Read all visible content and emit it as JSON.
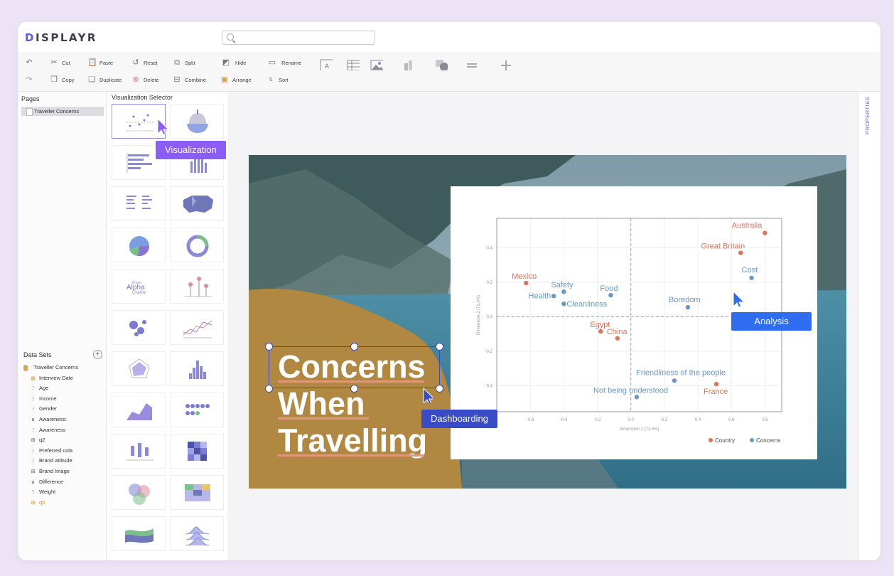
{
  "app": {
    "logo": "DISPLAYR",
    "search_placeholder": ""
  },
  "toolbar": {
    "row1": [
      "Cut",
      "Paste",
      "Reset",
      "Split",
      "Hide",
      "Rename"
    ],
    "row2": [
      "Copy",
      "Duplicate",
      "Delete",
      "Combine",
      "Arrange",
      "Sort"
    ]
  },
  "pages": {
    "title": "Pages",
    "items": [
      "Traveller Concerns"
    ]
  },
  "visualization_selector": {
    "title": "Visualization Selector"
  },
  "data_sets": {
    "title": "Data Sets",
    "root": "Traveller Concerns",
    "items": [
      {
        "icon": "calendar",
        "label": "Interview Date"
      },
      {
        "icon": "numeric",
        "label": "Age"
      },
      {
        "icon": "numeric",
        "label": "Income"
      },
      {
        "icon": "numeric",
        "label": "Gender"
      },
      {
        "icon": "text",
        "label": "Awareness:"
      },
      {
        "icon": "numeric",
        "label": "Awareness"
      },
      {
        "icon": "grid",
        "label": "q2"
      },
      {
        "icon": "numeric",
        "label": "Preferred cola"
      },
      {
        "icon": "numeric",
        "label": "Brand attitude"
      },
      {
        "icon": "grid",
        "label": "Brand Image"
      },
      {
        "icon": "text",
        "label": "Difference"
      },
      {
        "icon": "numeric",
        "label": "Weight"
      },
      {
        "icon": "grid-orange",
        "label": "q5"
      }
    ]
  },
  "properties_label": "PROPERTIES",
  "slide": {
    "headline": [
      "Concerns",
      "When",
      "Travelling"
    ]
  },
  "tags": {
    "visualization": "Visualization",
    "analysis": "Analysis",
    "dashboarding": "Dashboarding"
  },
  "colors": {
    "country": "#d9765a",
    "concerns": "#6a98c4",
    "accent_purple": "#8b5cf6",
    "accent_blue": "#2f6df0",
    "accent_navy": "#3a4bc8",
    "banner_gold": "#b08841"
  },
  "chart_data": {
    "type": "scatter",
    "xlabel": "Dimension 1 (71.0%)",
    "ylabel": "Dimension 2 (71.0%)",
    "xlim": [
      -0.8,
      0.9
    ],
    "ylim": [
      -0.55,
      0.57
    ],
    "x_ticks": [
      "-0.6",
      "-0.4",
      "-0.2",
      "0.0",
      "0.2",
      "0.4",
      "0.6",
      "0.8"
    ],
    "y_ticks": [
      "0.4",
      "0.2",
      "0.0",
      "-0.2",
      "-0.4"
    ],
    "grid": true,
    "legend": [
      "Country",
      "Concerns"
    ],
    "legend_position": "bottom-right",
    "series": [
      {
        "name": "Country",
        "points": [
          {
            "label": "Australia",
            "x": 0.8,
            "y": 0.485
          },
          {
            "label": "Great Britain",
            "x": 0.655,
            "y": 0.37
          },
          {
            "label": "Mexico",
            "x": -0.625,
            "y": 0.195
          },
          {
            "label": "Egypt",
            "x": -0.18,
            "y": -0.085
          },
          {
            "label": "China",
            "x": -0.08,
            "y": -0.125
          },
          {
            "label": "France",
            "x": 0.51,
            "y": -0.39
          }
        ]
      },
      {
        "name": "Concerns",
        "points": [
          {
            "label": "Cost",
            "x": 0.72,
            "y": 0.225
          },
          {
            "label": "Safety",
            "x": -0.4,
            "y": 0.145
          },
          {
            "label": "Health",
            "x": -0.46,
            "y": 0.12
          },
          {
            "label": "Food",
            "x": -0.12,
            "y": 0.125
          },
          {
            "label": "Cleanliness",
            "x": -0.4,
            "y": 0.075
          },
          {
            "label": "Boredom",
            "x": 0.34,
            "y": 0.055
          },
          {
            "label": "Friendliness of the people",
            "x": 0.26,
            "y": -0.37
          },
          {
            "label": "Not being understood",
            "x": 0.035,
            "y": -0.465
          }
        ]
      }
    ]
  }
}
